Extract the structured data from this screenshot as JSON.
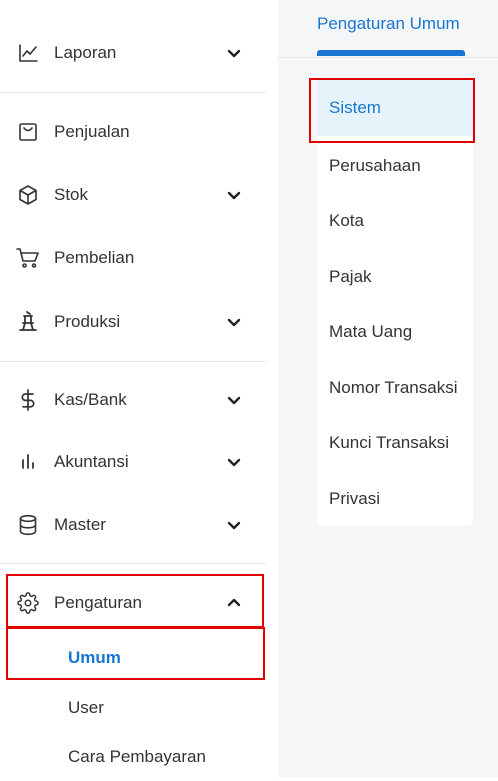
{
  "sidebar": {
    "items": [
      {
        "label": "Laporan",
        "icon": "chart-line-icon",
        "expandable": true
      },
      {
        "label": "Penjualan",
        "icon": "sales-box-icon",
        "expandable": false
      },
      {
        "label": "Stok",
        "icon": "cube-icon",
        "expandable": true
      },
      {
        "label": "Pembelian",
        "icon": "cart-icon",
        "expandable": false
      },
      {
        "label": "Produksi",
        "icon": "factory-icon",
        "expandable": true
      },
      {
        "label": "Kas/Bank",
        "icon": "dollar-icon",
        "expandable": true
      },
      {
        "label": "Akuntansi",
        "icon": "bar-chart-icon",
        "expandable": true
      },
      {
        "label": "Master",
        "icon": "database-icon",
        "expandable": true
      },
      {
        "label": "Pengaturan",
        "icon": "gear-icon",
        "expandable": true,
        "expanded": true
      }
    ],
    "submenu": [
      {
        "label": "Umum",
        "active": true
      },
      {
        "label": "User"
      },
      {
        "label": "Cara Pembayaran"
      }
    ]
  },
  "content": {
    "tab_label": "Pengaturan Umum",
    "menu": [
      {
        "label": "Sistem",
        "active": true
      },
      {
        "label": "Perusahaan"
      },
      {
        "label": "Kota"
      },
      {
        "label": "Pajak"
      },
      {
        "label": "Mata Uang"
      },
      {
        "label": "Nomor Transaksi"
      },
      {
        "label": "Kunci Transaksi"
      },
      {
        "label": "Privasi"
      }
    ]
  },
  "colors": {
    "accent": "#1976d2",
    "highlight_border": "#e00000",
    "active_bg": "#e6f3fb",
    "content_bg": "#f5f6f7"
  }
}
